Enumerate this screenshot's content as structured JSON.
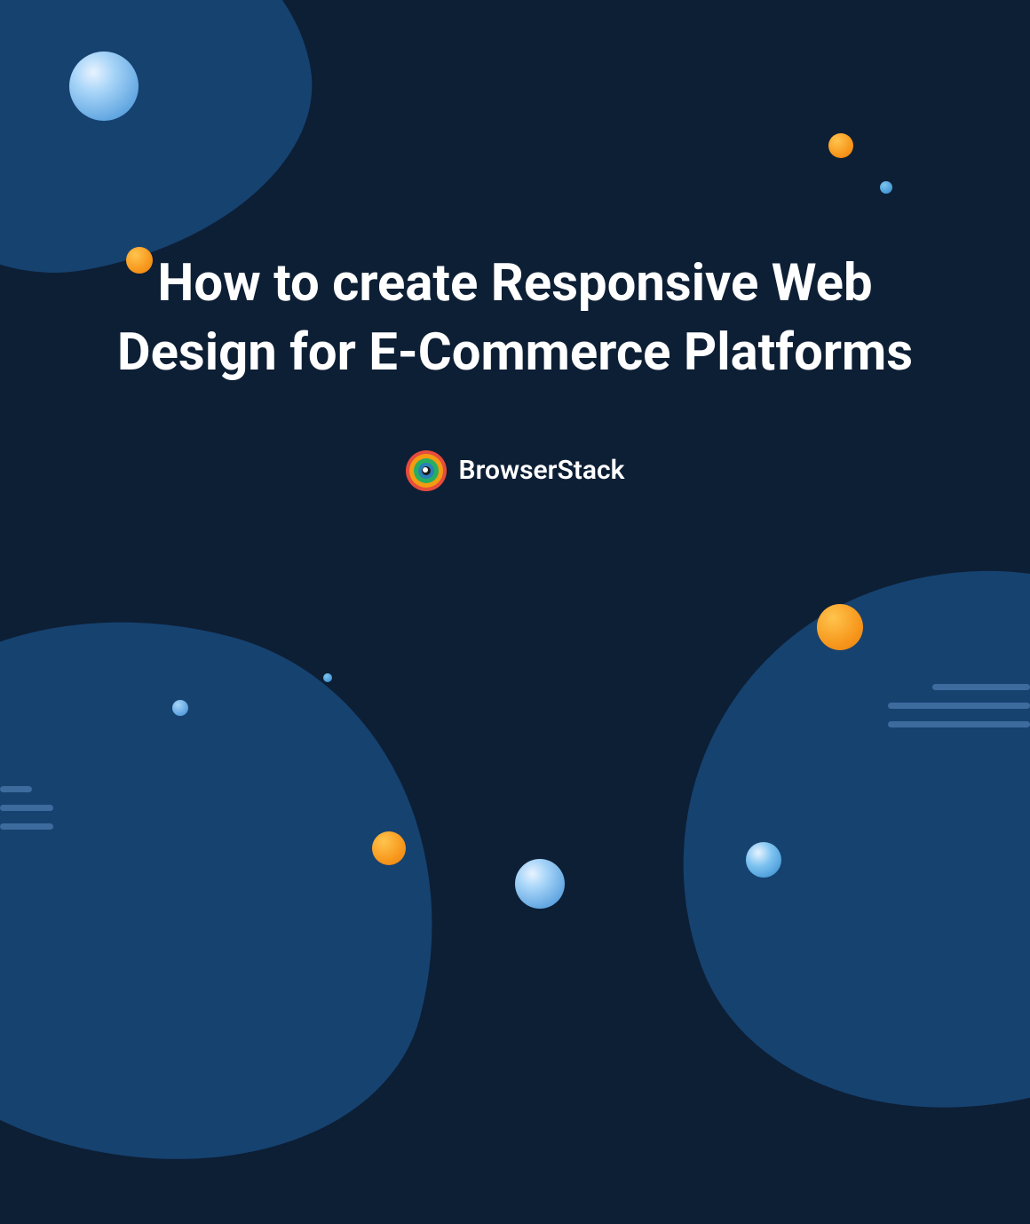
{
  "title": "How to create Responsive Web Design for E-Commerce Platforms",
  "brand_name": "BrowserStack"
}
